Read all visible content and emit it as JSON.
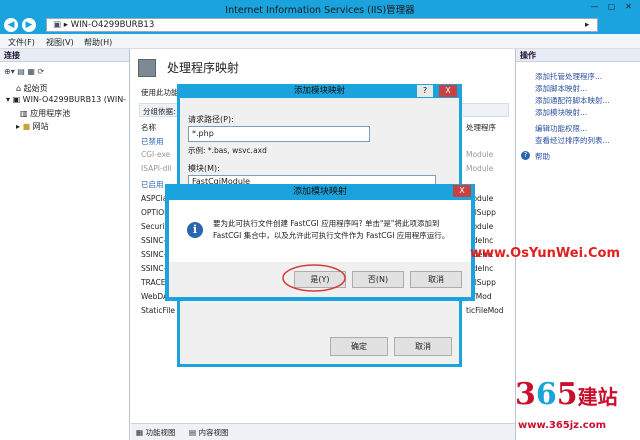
{
  "window": {
    "title": "Internet Information Services (IIS)管理器",
    "address": "WIN-O4299BURB13",
    "addr_sep": "▸"
  },
  "menu": [
    "文件(F)",
    "视图(V)",
    "帮助(H)"
  ],
  "connections": {
    "header": "连接",
    "tree": [
      "起始页",
      "WIN-O4299BURB13 (WIN-",
      "应用程序池",
      "网站"
    ]
  },
  "center": {
    "title": "处理程序映射",
    "desc": "使用此功能",
    "group": "分组依据:",
    "col_name": "名称",
    "col_right": "处理程序",
    "disabled_header": "已禁用",
    "enabled_header": "已启用",
    "rows_disabled": [
      "CGI-exe",
      "ISAPI-dll"
    ],
    "rows_disabled_right": [
      "Module",
      "Module"
    ],
    "rows_enabled": [
      "ASPClass",
      "OPTIONS",
      "Security",
      "SSINC-s",
      "SSINC-s",
      "SSINC-s",
      "TRACEVe",
      "WebDAV",
      "StaticFile"
    ],
    "rows_enabled_right": [
      "Module",
      "colSupp",
      "Module",
      "SideInc",
      "SideInc",
      "SideInc",
      "colSupp",
      "AVMod",
      "ticFileMod"
    ]
  },
  "status": {
    "features_view": "功能视图",
    "content_view": "内容视图"
  },
  "actions": {
    "header": "操作",
    "items": [
      "添加托管处理程序...",
      "添加脚本映射...",
      "添加通配符脚本映射...",
      "添加模块映射...",
      "编辑功能权限...",
      "查看经过排序的列表..."
    ],
    "help": "帮助"
  },
  "dialog_add": {
    "title": "添加模块映射",
    "help": "?",
    "close": "X",
    "path_label": "请求路径(P):",
    "path_value": "*.php",
    "example": "示例: *.bas, wsvc.axd",
    "module_label": "模块(M):",
    "module_value": "FastCgiModule",
    "ok": "确定",
    "cancel": "取消"
  },
  "dialog_confirm": {
    "title": "添加模块映射",
    "close": "X",
    "message": "要为此可执行文件创建 FastCGI 应用程序吗? 单击\"是\"将此项添加到 FastCGI 集合中，以及允许此可执行文件作为 FastCGI 应用程序运行。",
    "yes": "是(Y)",
    "no": "否(N)",
    "cancel": "取消"
  },
  "watermark": {
    "top": "www.OsYunWei.Com",
    "logo_a": "3",
    "logo_b": "6",
    "logo_c": "5",
    "logo_text": "建站",
    "bottom": "www.365jz.com"
  },
  "colors": {
    "accent": "#1aa3dc",
    "link": "#2a4fa0",
    "watermark": "#e02020",
    "ellipse": "#d23b3b"
  }
}
